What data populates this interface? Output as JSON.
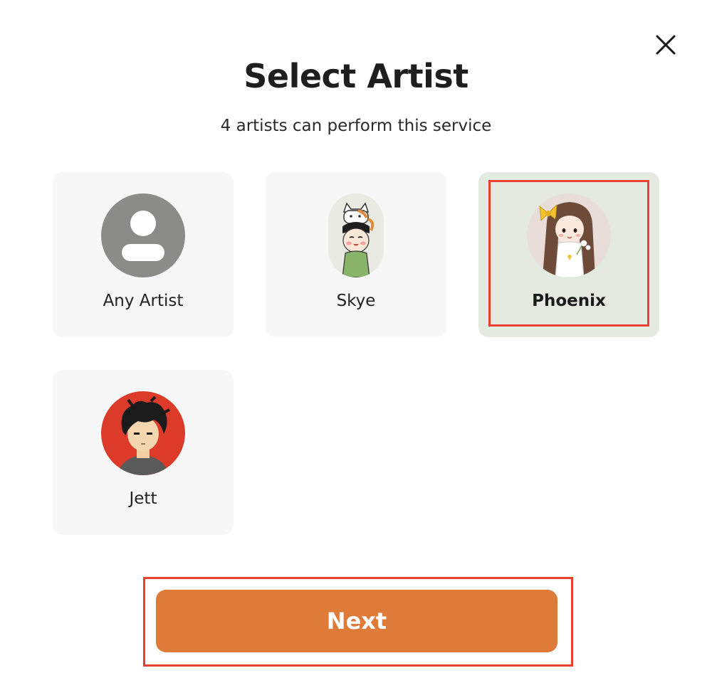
{
  "modal": {
    "title": "Select Artist",
    "subtitle": "4 artists can perform this service",
    "close_icon": "close-icon"
  },
  "artists": [
    {
      "label": "Any Artist",
      "avatar": "generic-user-icon",
      "selected": false
    },
    {
      "label": "Skye",
      "avatar": "cartoon-avatar-cat-hat",
      "selected": false
    },
    {
      "label": "Phoenix",
      "avatar": "cartoon-avatar-girl-bow",
      "selected": true
    },
    {
      "label": "Jett",
      "avatar": "cartoon-avatar-boy-red",
      "selected": false
    }
  ],
  "actions": {
    "next_label": "Next"
  },
  "colors": {
    "accent": "#df7b38",
    "selected_card": "#e4eadf",
    "card": "#f7f7f7",
    "highlight": "#e8412f"
  }
}
